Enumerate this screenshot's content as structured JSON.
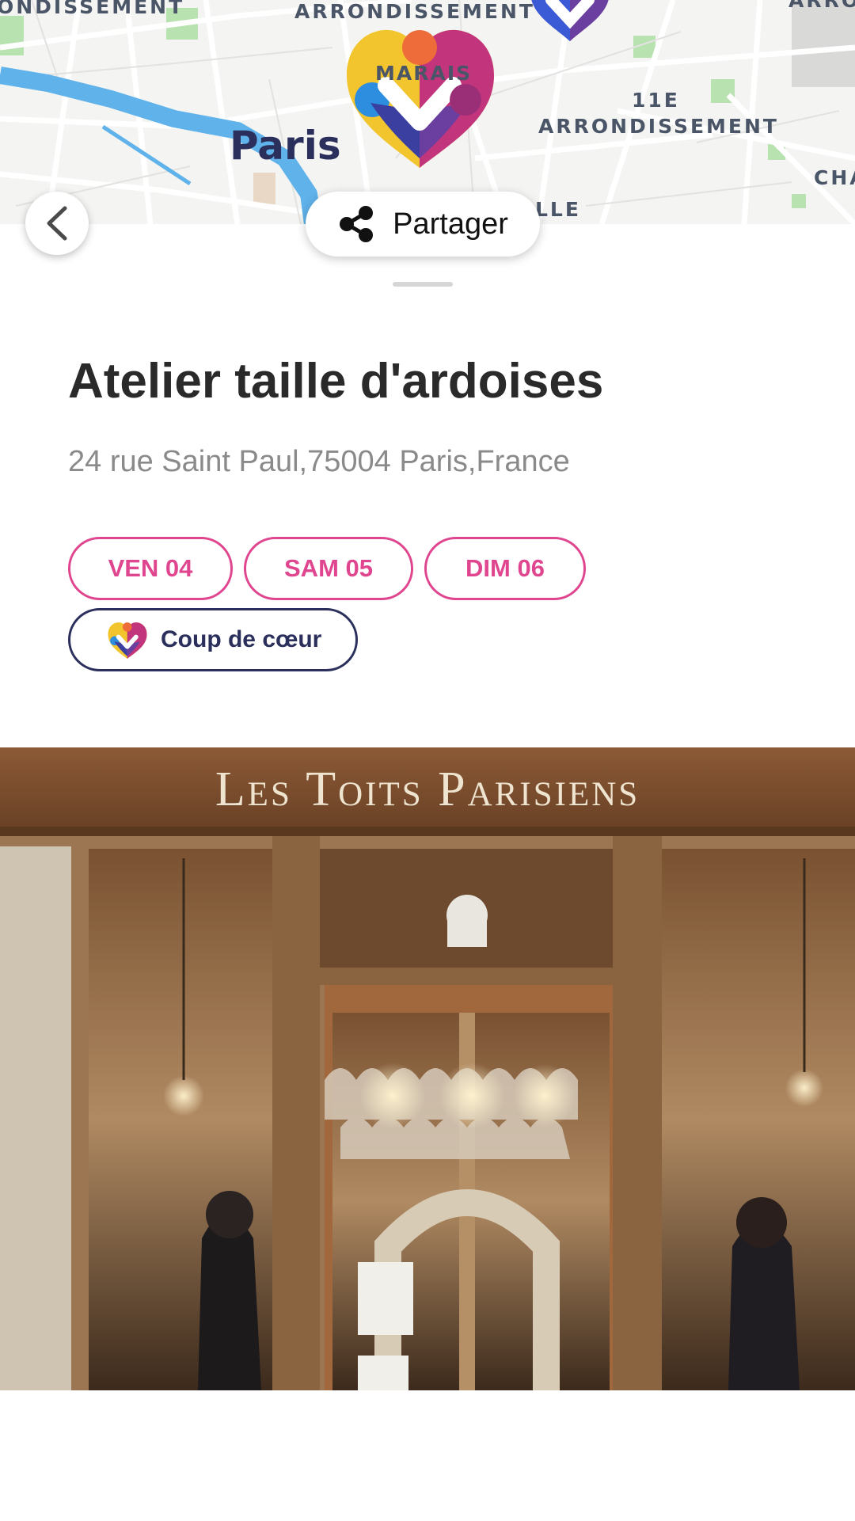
{
  "map": {
    "labels": {
      "arr_top_left": "ONDISSEMENT",
      "arr_top_center": "ARRONDISSEMENT",
      "arr_top_right": "ARRO",
      "marais": "MARAIS",
      "eleven_num": "11E",
      "eleven_arr": "ARRONDISSEMENT",
      "cha": "CHA",
      "ville": "LLE",
      "city": "Paris"
    },
    "colors": {
      "water": "#5fb2ea",
      "roads": "#ffffff",
      "parks": "#a7dba0",
      "land": "#f4f4f2"
    }
  },
  "nav": {
    "back_icon": "chevron-left-icon",
    "share_icon": "share-icon",
    "share_label": "Partager"
  },
  "place": {
    "title": "Atelier taille d'ardoises",
    "address": "24 rue Saint Paul,75004 Paris,France"
  },
  "dates": [
    {
      "label": "VEN 04"
    },
    {
      "label": "SAM 05"
    },
    {
      "label": "DIM 06"
    }
  ],
  "badge": {
    "icon": "heart-logo-icon",
    "label": "Coup de cœur"
  },
  "photo": {
    "sign_text": "Les Toits Parisiens"
  },
  "theme": {
    "accent_pink": "#e0468f",
    "navy": "#2b2f5c"
  }
}
